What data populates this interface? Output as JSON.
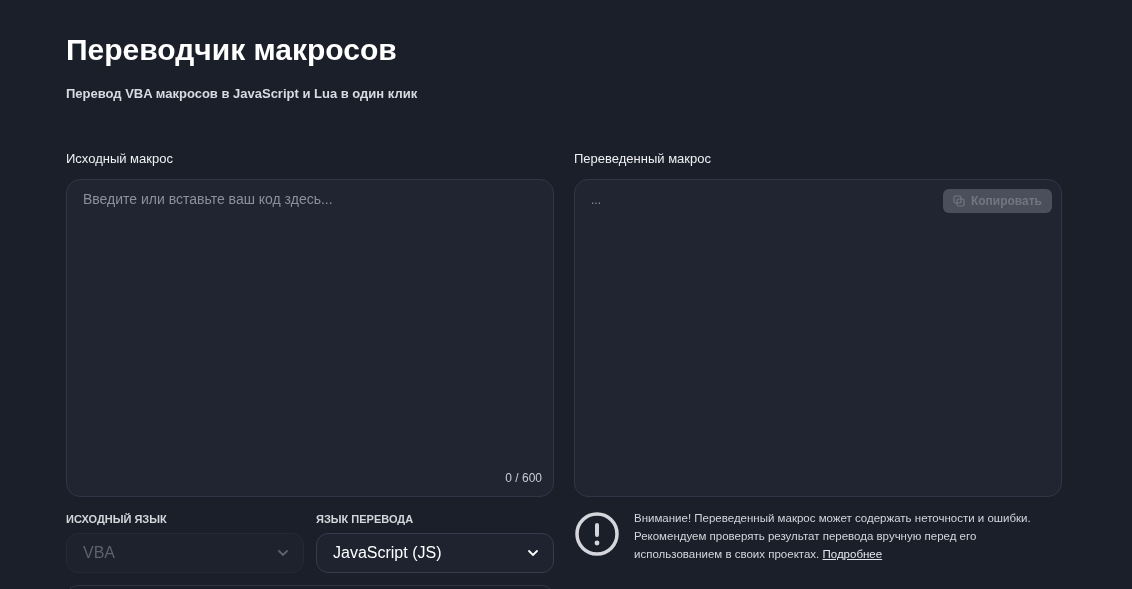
{
  "header": {
    "title": "Переводчик макросов",
    "subtitle": "Перевод VBA макросов в JavaScript и Lua в один клик"
  },
  "source": {
    "label": "Исходный макрос",
    "placeholder": "Введите или вставьте ваш код здесь...",
    "counter": "0 / 600"
  },
  "target": {
    "label": "Переведенный макрос",
    "placeholder": "...",
    "copy_button": {
      "label": "Копировать",
      "disabled": true
    }
  },
  "selects": [
    {
      "label": "ИСХОДНЫЙ ЯЗЫК",
      "value": "VBA",
      "disabled": true
    },
    {
      "label": "ЯЗЫК ПЕРЕВОДА",
      "value": "JavaScript (JS)",
      "disabled": false
    }
  ],
  "notice": {
    "text": "Внимание! Переведенный макрос может содержать неточности и ошибки. Рекомендуем проверять результат перевода вручную перед его использованием в своих проектах.",
    "link": "Подробнее"
  }
}
